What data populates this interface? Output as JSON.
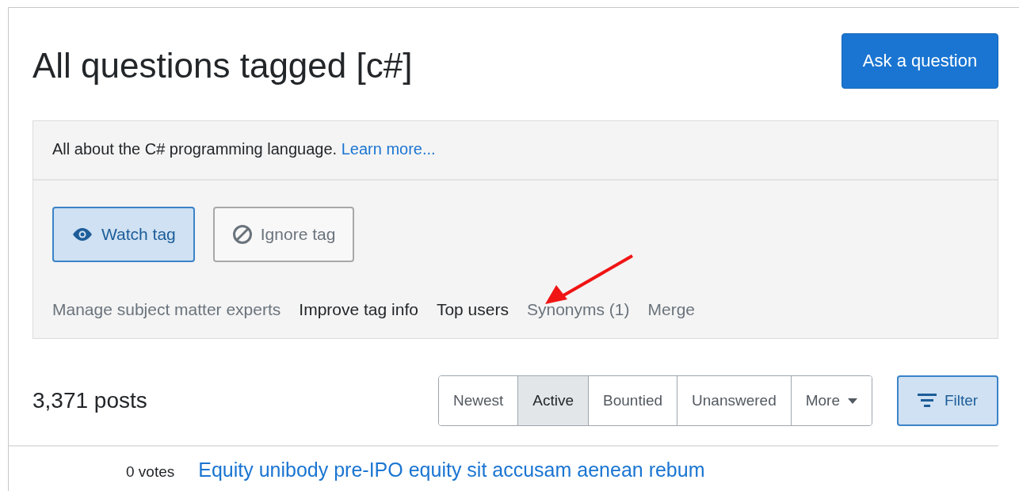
{
  "title": "All questions tagged [c#]",
  "ask_button": "Ask a question",
  "tag_info": {
    "description": "All about the C# programming language.",
    "learn_more": "Learn more..."
  },
  "tag_buttons": [
    {
      "label": "Watch tag",
      "kind": "watch",
      "selected": true
    },
    {
      "label": "Ignore tag",
      "kind": "ignore",
      "selected": false
    }
  ],
  "tag_links": [
    {
      "label": "Manage subject matter experts",
      "highlighted": false
    },
    {
      "label": "Improve tag info",
      "highlighted": true
    },
    {
      "label": "Top users",
      "highlighted": true
    },
    {
      "label": "Synonyms (1)",
      "highlighted": false
    },
    {
      "label": "Merge",
      "highlighted": false
    }
  ],
  "posts_count": "3,371 posts",
  "sort_tabs": [
    {
      "label": "Newest",
      "selected": false,
      "kind": "tab"
    },
    {
      "label": "Active",
      "selected": true,
      "kind": "tab"
    },
    {
      "label": "Bountied",
      "selected": false,
      "kind": "tab"
    },
    {
      "label": "Unanswered",
      "selected": false,
      "kind": "tab"
    },
    {
      "label": "More",
      "selected": false,
      "kind": "dropdown"
    }
  ],
  "filter_button": "Filter",
  "question": {
    "votes": "0 votes",
    "title": "Equity unibody pre-IPO equity sit accusam aenean rebum"
  }
}
